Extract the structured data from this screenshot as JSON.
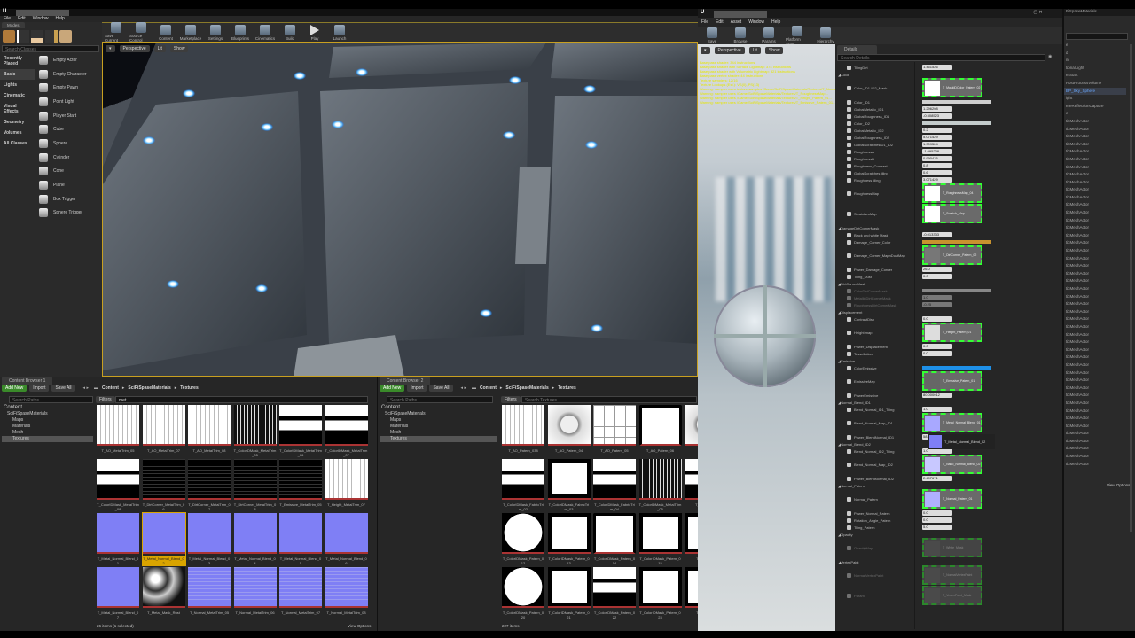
{
  "editor": {
    "menu": [
      "File",
      "Edit",
      "Window",
      "Help"
    ],
    "modes_tab": "Modes",
    "toolbar": [
      "Save Current",
      "Source Control",
      "Content",
      "Marketplace",
      "Settings",
      "Blueprints",
      "Cinematics",
      "Build",
      "Play",
      "Launch"
    ],
    "search_classes": "Search Classes",
    "categories": [
      "Recently Placed",
      "Basic",
      "Lights",
      "Cinematic",
      "Visual Effects",
      "Geometry",
      "Volumes",
      "All Classes"
    ],
    "items": [
      "Empty Actor",
      "Empty Character",
      "Empty Pawn",
      "Point Light",
      "Player Start",
      "Cube",
      "Sphere",
      "Cylinder",
      "Cone",
      "Plane",
      "Box Trigger",
      "Sphere Trigger"
    ],
    "viewport_buttons": [
      "Perspective",
      "Lit",
      "Show"
    ]
  },
  "browser1": {
    "tab": "Content Browser 1",
    "add_new": "Add New",
    "import": "Import",
    "save_all": "Save All",
    "breadcrumb": [
      "Content",
      "SciFiSpaseMaterials",
      "Textures"
    ],
    "search_paths": "Search Paths",
    "filters": "Filters",
    "search_value": "met",
    "tree": [
      "Content",
      "SciFiSpaseMaterials",
      "Maps",
      "Materials",
      "Mesh",
      "Textures"
    ],
    "assets": [
      {
        "name": "T_AO_MetalTrim_05",
        "p": "p-white"
      },
      {
        "name": "T_AO_MetalTrim_07",
        "p": "p-white"
      },
      {
        "name": "T_AO_MetalTrim_08",
        "p": "p-white"
      },
      {
        "name": "T_ColorIDMask_MetalTrim_05",
        "p": "p-black"
      },
      {
        "name": "T_ColorIDMask_MetalTrim_06",
        "p": "p-mask"
      },
      {
        "name": "T_ColorIDMask_MetalTrim_07",
        "p": "p-mask"
      },
      {
        "name": "T_ColorIDMask_MetalTrim_08",
        "p": "p-mask"
      },
      {
        "name": "T_DirtCorner_MetalTrim_06",
        "p": "p-dark"
      },
      {
        "name": "T_DirtCorner_MetalTrim_07",
        "p": "p-dark"
      },
      {
        "name": "T_DirtCorner_MetalTrim_08",
        "p": "p-dark"
      },
      {
        "name": "T_Emissive_MetalTrim_05",
        "p": "p-dark"
      },
      {
        "name": "T_Height_MetalTrim_07",
        "p": "p-white"
      },
      {
        "name": "T_Metal_Normal_Blend_01",
        "p": "p-normal"
      },
      {
        "name": "T_Metal_Normal_Blend_02",
        "p": "p-normal",
        "selected": true
      },
      {
        "name": "T_Metal_Normal_Blend_03",
        "p": "p-normal"
      },
      {
        "name": "T_Metal_Normal_Blend_04",
        "p": "p-normal"
      },
      {
        "name": "T_Metal_Normal_Blend_05",
        "p": "p-normal"
      },
      {
        "name": "T_Metal_Normal_Blend_06",
        "p": "p-normal"
      },
      {
        "name": "T_Metal_Normal_Blend_07",
        "p": "p-normal"
      },
      {
        "name": "T_Metal_Mask_Rust",
        "p": "p-noise"
      },
      {
        "name": "T_Normal_MetalTrim_05",
        "p": "p-normal2"
      },
      {
        "name": "T_Normal_MetalTrim_06",
        "p": "p-normal2"
      },
      {
        "name": "T_Normal_MetalTrim_07",
        "p": "p-normal2"
      },
      {
        "name": "T_Normal_MetalTrim_08",
        "p": "p-normal2"
      }
    ],
    "status": "26 items (1 selected)",
    "view_options": "View Options"
  },
  "browser2": {
    "tab": "Content Browser 2",
    "add_new": "Add New",
    "import": "Import",
    "save_all": "Save All",
    "breadcrumb": [
      "Content",
      "SciFiSpaseMaterials",
      "Textures"
    ],
    "search_paths": "Search Paths",
    "filters": "Filters",
    "search_placeholder": "Search Textures",
    "tree": [
      "Content",
      "SciFiSpaseMaterials",
      "Maps",
      "Materials",
      "Mesh",
      "Textures"
    ],
    "assets": [
      {
        "name": "T_AO_Patern_038",
        "p": "p-white"
      },
      {
        "name": "T_AO_Patern_04",
        "p": "p-round"
      },
      {
        "name": "T_AO_Patern_05",
        "p": "p-grid"
      },
      {
        "name": "T_AO_Patern_06",
        "p": "p-white2"
      },
      {
        "name": "T_AO_",
        "p": "p-round"
      },
      {
        "name": "T_ColorIDMask_FabricTrim_02",
        "p": "p-mask"
      },
      {
        "name": "T_ColorIDMask_FabricTrim_03",
        "p": "p-frame"
      },
      {
        "name": "T_ColorIDMask_FabricTrim_04",
        "p": "p-mask"
      },
      {
        "name": "T_ColorIDMask_MetalTrim_05",
        "p": "p-black"
      },
      {
        "name": "T_ColorIDMa",
        "p": "p-mask"
      },
      {
        "name": "T_ColorIDMask_Patern_012",
        "p": "p-oct"
      },
      {
        "name": "T_ColorIDMask_Patern_013",
        "p": "p-frame"
      },
      {
        "name": "T_ColorIDMask_Patern_014",
        "p": "p-white2"
      },
      {
        "name": "T_ColorIDMask_Patern_015",
        "p": "p-frame"
      },
      {
        "name": "T_ColorIDM",
        "p": "p-frame"
      },
      {
        "name": "T_ColorIDMask_Patern_020",
        "p": "p-oct"
      },
      {
        "name": "T_ColorIDMask_Patern_021",
        "p": "p-frame"
      },
      {
        "name": "T_ColorIDMask_Patern_022",
        "p": "p-mask"
      },
      {
        "name": "T_ColorIDMask_Patern_023",
        "p": "p-frame"
      },
      {
        "name": "T_ColorIDM",
        "p": "p-frame"
      }
    ],
    "status": "227 items"
  },
  "material_editor": {
    "menu": [
      "File",
      "Edit",
      "Asset",
      "Window",
      "Help"
    ],
    "toolbar": [
      "Save",
      "Browse",
      "Params",
      "Platform Stats",
      "Hierarchy"
    ],
    "viewport_buttons": [
      "Perspective",
      "Lit",
      "Show"
    ],
    "stats": [
      "Base pass shader: 344 instructions",
      "Base pass shader with Surface Lightmap: 374 instructions",
      "Base pass shader with Volumetric Lightmap: 321 instructions",
      "Base pass vertex shader: 44 instructions",
      "Texture samplers: 12/16",
      "Texture Lookups (Est.): VS(0), PS(13)",
      "Warning: sampler uses texture samples /Game/SciFiSpaseMaterials/Textures/T_NormalMap...",
      "Warning: sampler uses /Game/SciFiSpaseMaterials/Textures/T_RoughnessMap...",
      "Warning: sampler uses /Game/SciFiSpaseMaterials/Textures/T_Height_Patern_01...",
      "Warning: sampler uses /Game/SciFiSpaseMaterials/Textures/T_Emissive_Patern_01..."
    ],
    "details_tab": "Details",
    "search_details": "Search Details",
    "properties": [
      {
        "t": "row",
        "name": "TilingDirt",
        "value": "1.461526"
      },
      {
        "t": "group",
        "name": "Color"
      },
      {
        "t": "tex",
        "name": "Color_ID1-ID2_Mask",
        "value": "T_MaskIDColor_Patern_02"
      },
      {
        "t": "color",
        "name": "Color_ID1",
        "color": "#cfcfcf"
      },
      {
        "t": "row",
        "name": "GlobalMetallic_ID1",
        "value": "1.296208"
      },
      {
        "t": "row",
        "name": "GlobalRoughness_ID1",
        "value": "-0.508523"
      },
      {
        "t": "color",
        "name": "Color_ID2",
        "color": "#c4cccc"
      },
      {
        "t": "row",
        "name": "GlobalMetallic_ID2",
        "value": "0.2"
      },
      {
        "t": "row",
        "name": "GlobalRoughness_ID2",
        "value": "5.071429"
      },
      {
        "t": "row",
        "name": "GlobalScratchesID1_ID2",
        "value": "1.309524"
      },
      {
        "t": "row",
        "name": "RoughnessA",
        "value": "-1.095238"
      },
      {
        "t": "row",
        "name": "RoughnessB",
        "value": "0.990476"
      },
      {
        "t": "row",
        "name": "Roughness_Contrast",
        "value": "0.8"
      },
      {
        "t": "row",
        "name": "GlobalScratches tiling",
        "value": "0.6"
      },
      {
        "t": "row",
        "name": "Roughness tiling",
        "value": "3.071429"
      },
      {
        "t": "tex",
        "name": "RoughnessMap",
        "value": "T_RoughnessMap_04"
      },
      {
        "t": "tex",
        "name": "ScratchesMap",
        "value": "T_Scratch_Map"
      },
      {
        "t": "group",
        "name": "DamageDirtCornerMask"
      },
      {
        "t": "row",
        "name": "Black and white Mask",
        "value": "-0.013333"
      },
      {
        "t": "color",
        "name": "Damage_Corner_Color",
        "color": "#c8922e"
      },
      {
        "t": "tex",
        "name": "Damage_Corner_MapnDustMap",
        "value": "T_DirtCorner_Patern_02",
        "sw": "#777"
      },
      {
        "t": "row",
        "name": "Power_Damage_Corner",
        "value": "26.0"
      },
      {
        "t": "row",
        "name": "Tiling_Dust",
        "value": "0.0"
      },
      {
        "t": "group",
        "name": "DirtCornerMask"
      },
      {
        "t": "color",
        "name": "ColorDirtCornerMask",
        "color": "#ffffff",
        "dis": true
      },
      {
        "t": "row",
        "name": "MetallicDirtCornerMask",
        "value": "1.0",
        "dis": true
      },
      {
        "t": "row",
        "name": "RoughnessDirtCornerMask",
        "value": "-0.25",
        "dis": true
      },
      {
        "t": "group",
        "name": "Displacement"
      },
      {
        "t": "row",
        "name": "ContrastDisp",
        "value": "0.0"
      },
      {
        "t": "tex",
        "name": "Height map",
        "value": "T_Height_Patern_01",
        "sw": "#ddd"
      },
      {
        "t": "row",
        "name": "Power_Displacement",
        "value": "0.0"
      },
      {
        "t": "row",
        "name": "Tessellation",
        "value": "0.0"
      },
      {
        "t": "group",
        "name": "Emissive"
      },
      {
        "t": "color",
        "name": "ColorEmissive",
        "color": "#1e90e8"
      },
      {
        "t": "tex",
        "name": "EmissiveMap",
        "value": "T_Emissive_Patern_01",
        "sw": "#666"
      },
      {
        "t": "row",
        "name": "PowerEmissive",
        "value": "80.000012"
      },
      {
        "t": "group",
        "name": "Normal_Blend_ID1"
      },
      {
        "t": "row",
        "name": "Blend_Normal_ID1_Tiling",
        "value": "1.0"
      },
      {
        "t": "tex",
        "name": "Blend_Normal_Map_ID1",
        "value": "T_Metal_Normal_Blend_01",
        "sw": "#a8a8ff"
      },
      {
        "t": "row",
        "name": "Power_BlendNormal_ID1",
        "value": "58.773809"
      },
      {
        "t": "group",
        "name": "Normal_Blend_ID2"
      },
      {
        "t": "row",
        "name": "Blend_Normal_ID2_Tiling",
        "value": "1.0"
      },
      {
        "t": "tex",
        "name": "Blend_Normal_Map_ID2",
        "value": "T_Nano_Normal_Blend_02",
        "sw": "#c8c8ff"
      },
      {
        "t": "row",
        "name": "Power_BlendNormal_ID2",
        "value": "2.497671"
      },
      {
        "t": "group",
        "name": "Normal_Patern"
      },
      {
        "t": "tex",
        "name": "Normal_Patern",
        "value": "T_Normal_Patern_01",
        "sw": "#b0b0ff"
      },
      {
        "t": "row",
        "name": "Power_Normal_Patern",
        "value": "0.0"
      },
      {
        "t": "row",
        "name": "Rotation_Angle_Patern",
        "value": "0.0"
      },
      {
        "t": "row",
        "name": "Tiling_Patern",
        "value": "5.0"
      },
      {
        "t": "group",
        "name": "Opacity"
      },
      {
        "t": "tex",
        "name": "OpacityMap",
        "value": "T_White_Mask",
        "sw": "#777",
        "dis": true
      },
      {
        "t": "group",
        "name": "VertexPaint"
      },
      {
        "t": "tex",
        "name": "NormalVertexPaint",
        "value": "T_NormalVertexPaint",
        "sw": "#777",
        "dis": true
      },
      {
        "t": "tex",
        "name": "Param",
        "value": "T_VertexPaint_Mask",
        "sw": "#777",
        "dis": true
      }
    ],
    "drag_tooltip": "T_Metal_Normal_Blend_02"
  },
  "outliner": {
    "title": "FiSpaseMaterials",
    "items": [
      "e",
      "d",
      "m",
      "tionalLight",
      "erStart",
      "PostProcessVolume",
      "BP_Sky_Sphere",
      "ight",
      "ereReflectionCapture",
      "e",
      "ticMeshActor",
      "ticMeshActor",
      "ticMeshActor",
      "ticMeshActor",
      "ticMeshActor",
      "ticMeshActor",
      "ticMeshActor",
      "ticMeshActor",
      "ticMeshActor",
      "ticMeshActor",
      "ticMeshActor",
      "ticMeshActor",
      "ticMeshActor",
      "ticMeshActor",
      "ticMeshActor",
      "ticMeshActor",
      "ticMeshActor",
      "ticMeshActor",
      "ticMeshActor",
      "ticMeshActor",
      "ticMeshActor",
      "ticMeshActor",
      "ticMeshActor",
      "ticMeshActor",
      "ticMeshActor",
      "ticMeshActor",
      "ticMeshActor",
      "ticMeshActor",
      "ticMeshActor",
      "ticMeshActor",
      "ticMeshActor",
      "ticMeshActor",
      "ticMeshActor",
      "ticMeshActor",
      "ticMeshActor",
      "ticMeshActor",
      "ticMeshActor",
      "ticMeshActor",
      "ticMeshActor",
      "ticMeshActor",
      "ticMeshActor",
      "ticMeshActor",
      "ticMeshActor",
      "ticMeshActor",
      "ticMeshActor",
      "ticMeshActor"
    ],
    "selected_index": 6,
    "view_options": "View Options"
  }
}
